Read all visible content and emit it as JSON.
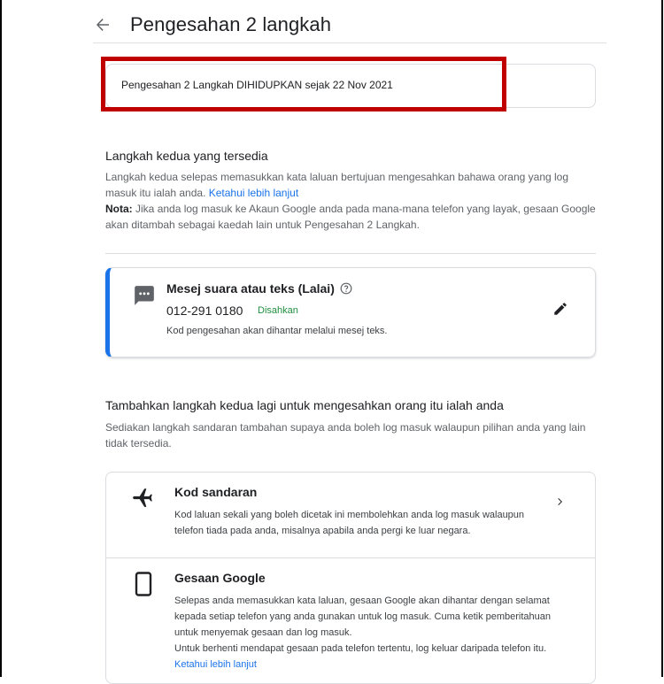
{
  "header": {
    "title": "Pengesahan 2 langkah",
    "back_icon": "arrow-back-icon"
  },
  "status": {
    "text": "Pengesahan 2 Langkah DIHIDUPKAN sejak 22 Nov 2021",
    "highlight_color": "#c00000"
  },
  "available": {
    "title": "Langkah kedua yang tersedia",
    "line1": "Langkah kedua selepas memasukkan kata laluan bertujuan mengesahkan bahawa orang yang log",
    "line2": "masuk itu ialah anda.",
    "learn_more": "Ketahui lebih lanjut",
    "note_label": "Nota:",
    "note_line1": "Jika anda log masuk ke Akaun Google anda pada mana-mana telefon yang layak, gesaan Google",
    "note_line2": "akan ditambah sebagai kaedah lain untuk Pengesahan 2 Langkah."
  },
  "method": {
    "title": "Mesej suara atau teks (Lalai)",
    "phone": "012-291 0180",
    "status": "Disahkan",
    "description": "Kod pengesahan akan dihantar melalui mesej teks.",
    "accent_color": "#1a73e8",
    "status_color": "#1e8e3e"
  },
  "add": {
    "title": "Tambahkan langkah kedua lagi untuk mengesahkan orang itu ialah anda",
    "line1": "Sediakan langkah sandaran tambahan supaya anda boleh log masuk walaupun pilihan anda yang lain",
    "line2": "tidak tersedia."
  },
  "options": [
    {
      "title": "Kod sandaran",
      "icon": "airplane-icon",
      "line1": "Kod laluan sekali yang boleh dicetak ini membolehkan anda log masuk walaupun",
      "line2": "telefon tiada pada anda, misalnya apabila anda pergi ke luar negara."
    },
    {
      "title": "Gesaan Google",
      "icon": "smartphone-icon",
      "line1": "Selepas anda memasukkan kata laluan, gesaan Google akan dihantar dengan selamat",
      "line2": "kepada setiap telefon yang anda gunakan untuk log masuk. Cuma ketik pemberitahuan",
      "line3": "untuk menyemak gesaan dan log masuk.",
      "line4": "Untuk berhenti mendapat gesaan pada telefon tertentu, log keluar daripada telefon itu.",
      "learn_more": "Ketahui lebih lanjut"
    }
  ]
}
